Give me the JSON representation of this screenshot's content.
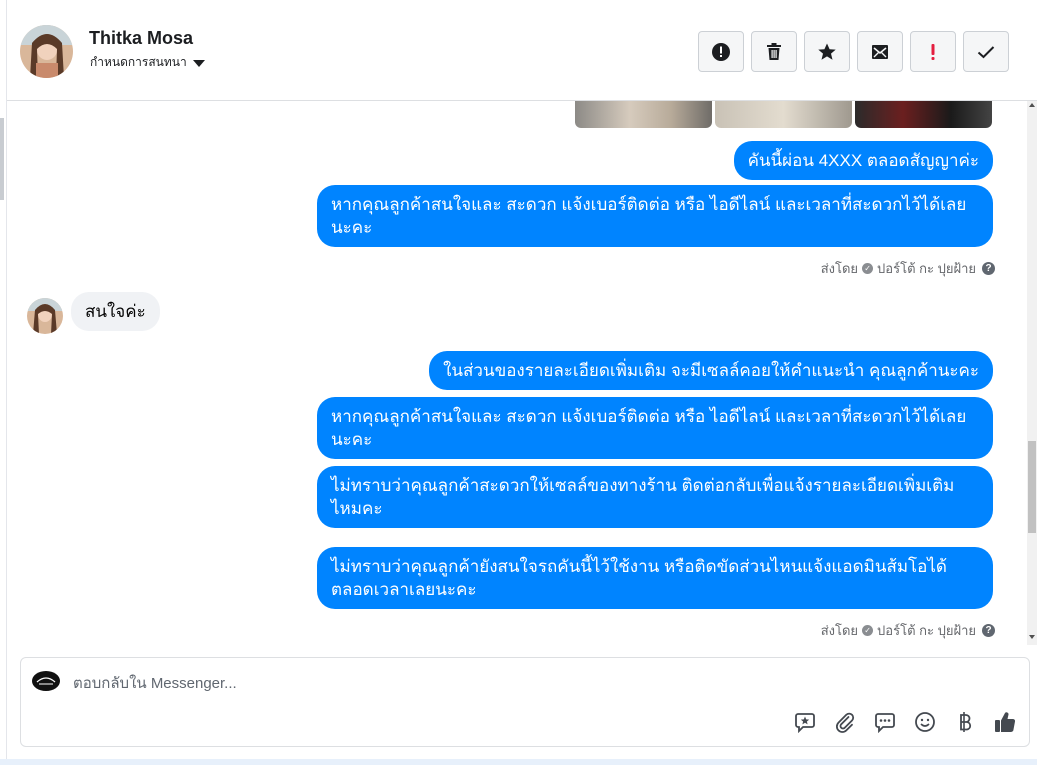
{
  "header": {
    "contact_name": "Thitka Mosa",
    "assign_label": "กำหนดการสนทนา",
    "actions": [
      {
        "name": "report-icon"
      },
      {
        "name": "trash-icon"
      },
      {
        "name": "star-icon"
      },
      {
        "name": "mark-unread-icon"
      },
      {
        "name": "spam-icon"
      },
      {
        "name": "checkmark-icon"
      }
    ]
  },
  "messages": {
    "m1": "คันนี้ผ่อน 4XXX ตลอดสัญญาค่ะ",
    "m2": "หากคุณลูกค้าสนใจและ สะดวก แจ้งเบอร์ติดต่อ หรือ ไอดีไลน์ และเวลาที่สะดวกไว้ได้เลยนะคะ",
    "sent_by_1": {
      "prefix": "ส่งโดย",
      "agent": "ปอร์โต้ กะ ปุยฝ้าย"
    },
    "incoming": "สนใจค่ะ",
    "m3": "ในส่วนของรายละเอียดเพิ่มเติม จะมีเซลล์คอยให้คำแนะนำ คุณลูกค้านะคะ",
    "m4": "หากคุณลูกค้าสนใจและ สะดวก แจ้งเบอร์ติดต่อ หรือ ไอดีไลน์ และเวลาที่สะดวกไว้ได้เลยนะคะ",
    "m5": "ไม่ทราบว่าคุณลูกค้าสะดวกให้เซลล์ของทางร้าน ติดต่อกลับเพื่อแจ้งรายละเอียดเพิ่มเติมไหมคะ",
    "m6": "ไม่ทราบว่าคุณลูกค้ายังสนใจรถคันนี้ไว้ใช้งาน หรือติดขัดส่วนไหนแจ้งแอดมินส้มโอได้ตลอดเวลาเลยนะคะ",
    "sent_by_2": {
      "prefix": "ส่งโดย",
      "agent": "ปอร์โต้ กะ ปุยฝ้าย"
    }
  },
  "composer": {
    "placeholder": "ตอบกลับใน Messenger...",
    "tools": [
      "saved-reply-icon",
      "attachment-icon",
      "quick-reply-icon",
      "emoji-icon",
      "baht-payment-icon",
      "thumbs-up-icon"
    ]
  },
  "colors": {
    "outgoing_bubble": "#0084ff",
    "incoming_bubble": "#f0f2f5",
    "spam_red": "#e41e3f"
  }
}
